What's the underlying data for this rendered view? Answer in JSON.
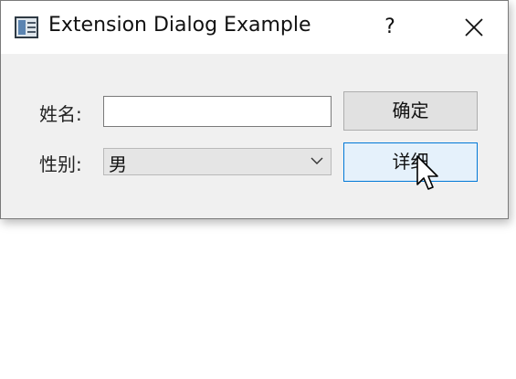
{
  "window": {
    "title": "Extension Dialog Example",
    "help_label": "?",
    "icons": {
      "app": "dialog-app-icon",
      "close": "close-icon",
      "cursor": "mouse-pointer-icon"
    }
  },
  "form": {
    "name_label": "姓名:",
    "name_value": "",
    "gender_label": "性别:",
    "gender_value": "男"
  },
  "buttons": {
    "ok_label": "确定",
    "detail_label": "详细"
  },
  "colors": {
    "dialog_bg": "#f0f0f0",
    "focus_border": "#0078d7",
    "focus_fill": "#e5f1fb"
  }
}
